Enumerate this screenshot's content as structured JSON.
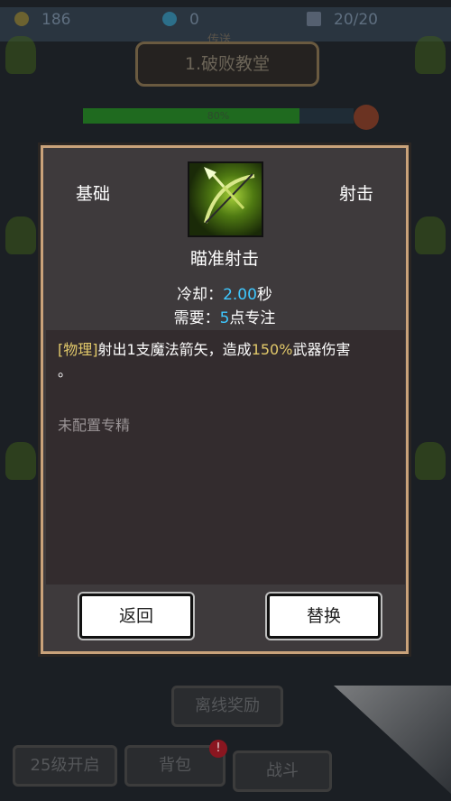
{
  "hud": {
    "gold": "186",
    "gems": "0",
    "energy": "20/20"
  },
  "stage": {
    "caption": "传送",
    "name": "1.破败教堂",
    "progress_text": "80%",
    "progress": 0.8
  },
  "dialog": {
    "tag_left": "基础",
    "tag_right": "射击",
    "skill_name": "瞄准射击",
    "cooldown_label": "冷却：",
    "cooldown_value": "2.00",
    "cooldown_unit": "秒",
    "require_label": "需要：",
    "require_value": "5",
    "require_unit": "点专注",
    "desc_tag": "[物理]",
    "desc_a": "射出1支魔法箭矢，造成",
    "desc_pct": "150%",
    "desc_b": "武器伤害",
    "desc_c": "。",
    "spec_status": "未配置专精",
    "back_label": "返回",
    "replace_label": "替换"
  },
  "bottom": {
    "auto_battle": "离线奖励",
    "left_btn": "25级开启",
    "bag": "背包",
    "battle": "战斗",
    "badge": "!"
  },
  "colors": {
    "accent_cyan": "#3ec8ff",
    "accent_yellow": "#e2c96a",
    "frame": "#c9a27a"
  }
}
